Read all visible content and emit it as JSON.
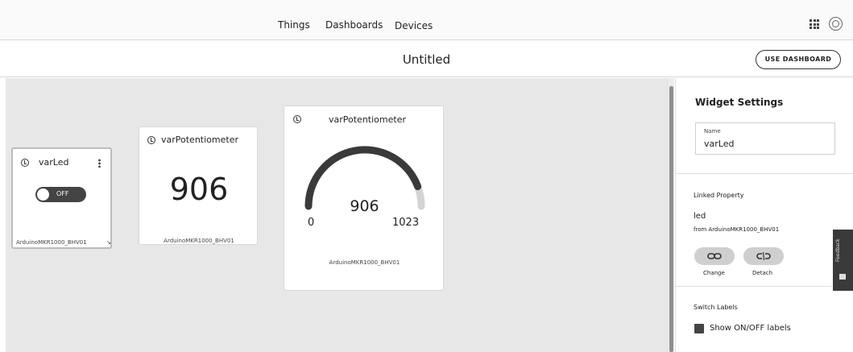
{
  "nav": {
    "things": "Things",
    "dashboards": "Dashboards",
    "devices": "Devices"
  },
  "toolbar": {
    "title": "Untitled",
    "use_dashboard": "USE DASHBOARD"
  },
  "widgets": {
    "led": {
      "title": "varLed",
      "toggle_label": "OFF",
      "device": "ArduinoMKR1000_BHV01"
    },
    "value": {
      "title": "varPotentiometer",
      "value": "906",
      "device": "ArduinoMKR1000_BHV01"
    },
    "gauge": {
      "title": "varPotentiometer",
      "value": "906",
      "min": "0",
      "max": "1023",
      "device": "ArduinoMKR1000_BHV01",
      "fraction": 0.886
    }
  },
  "settings": {
    "heading": "Widget Settings",
    "name_label": "Name",
    "name_value": "varLed",
    "linked_heading": "Linked Property",
    "property": "led",
    "source": "from ArduinoMKR1000_BHV01",
    "change": "Change",
    "detach": "Detach",
    "switch_heading": "Switch Labels",
    "show_labels": "Show ON/OFF labels"
  },
  "feedback": "Feedback",
  "colors": {
    "gauge_arc": "#3a3a3a",
    "gauge_track": "#d4d4d4",
    "toggle_bg": "#444444",
    "canvas_bg": "#e7e7e7"
  },
  "icons": [
    "apps-grid-icon",
    "user-icon",
    "history-icon",
    "kebab-menu-icon",
    "link-icon",
    "unlink-icon",
    "checkbox-icon"
  ]
}
